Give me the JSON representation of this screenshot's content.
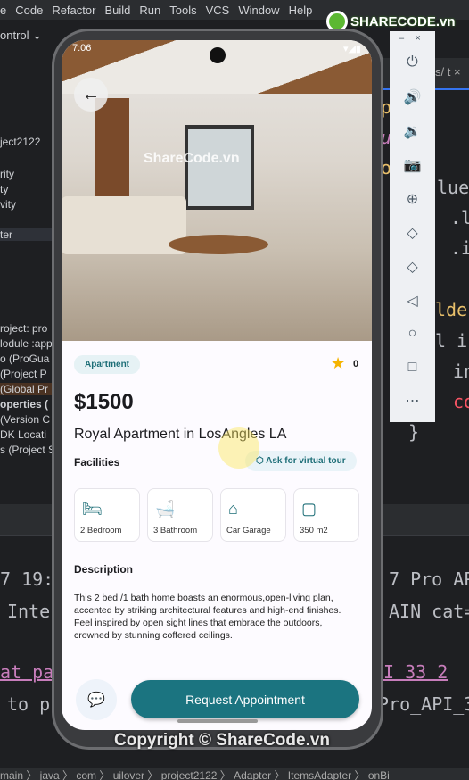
{
  "ide": {
    "menu": [
      "e",
      "Code",
      "Refactor",
      "Build",
      "Run",
      "Tools",
      "VCS",
      "Window",
      "Help"
    ],
    "toolbar_item": "ontrol ⌄",
    "sidebar_items": [
      "ject2122",
      "rity",
      "ty",
      "vity",
      "ter",
      "roject: pro",
      "lodule :app",
      "o (ProGua",
      "(Project P",
      "(Global Pr",
      "operties (",
      "(Version C",
      "DK Locati",
      "s (Project S"
    ],
    "tab": "s/  t ×",
    "code_lines": [
      "pter",
      "un c",
      "olde",
      "lue.",
      ".l",
      ".i",
      "lder",
      "l in",
      "in",
      "co",
      "}"
    ],
    "console_lines": [
      "7 19:0",
      "Inter",
      "at par",
      "to pr",
      "7 Pro API",
      "AIN cat=",
      "I 33 2",
      "Pro_API_3"
    ],
    "breadcrumb": "main 〉 java 〉 com 〉 uilover 〉 project2122 〉 Adapter 〉 ItemsAdapter 〉 onBi"
  },
  "watermark": {
    "logo": "SHARECODE.vn",
    "photo": "ShareCode.vn",
    "copyright": "Copyright © ShareCode.vn"
  },
  "emulator_controls": [
    "power-icon",
    "volume-up-icon",
    "volume-down-icon",
    "camera-icon",
    "zoom-icon",
    "rotate-left-icon",
    "rotate-right-icon",
    "back-icon",
    "home-icon",
    "overview-icon",
    "more-icon"
  ],
  "phone": {
    "status_time": "7:06",
    "category": "Apartment",
    "rating": "0",
    "price": "$1500",
    "title": "Royal Apartment in LosAngles LA",
    "facilities_heading": "Facilities",
    "virtual_tour": "Ask for virtual tour",
    "facilities": [
      {
        "icon": "bed-icon",
        "label": "2 Bedroom"
      },
      {
        "icon": "bathtub-icon",
        "label": "3 Bathroom"
      },
      {
        "icon": "garage-icon",
        "label": "Car Garage"
      },
      {
        "icon": "area-icon",
        "label": "350 m2"
      }
    ],
    "description_heading": "Description",
    "description": "This 2 bed /1 bath home boasts an enormous,open-living plan, accented by striking architectural features and high-end finishes. Feel inspired by open sight lines that embrace the outdoors, crowned by stunning coffered ceilings.",
    "request_button": "Request Appointment",
    "accent": "#1b7480"
  }
}
